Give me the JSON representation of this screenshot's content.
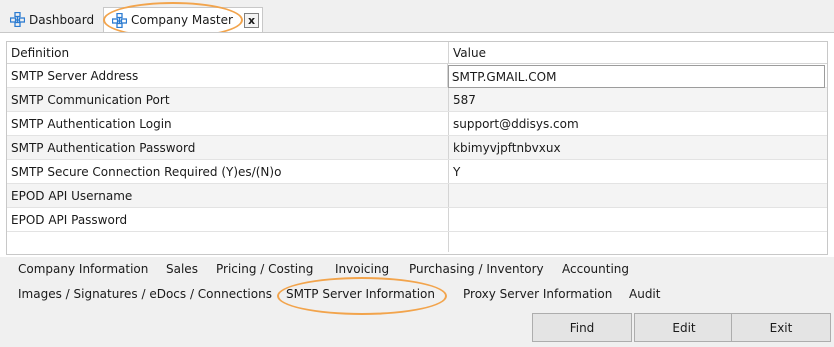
{
  "tabs": {
    "dashboard_label": "Dashboard",
    "company_label": "Company Master",
    "close_glyph": "x",
    "icon": "network-grid-icon",
    "icon_color": "#2b7bd1"
  },
  "grid": {
    "headers": {
      "definition": "Definition",
      "value": "Value"
    },
    "rows": [
      {
        "definition": "SMTP Server Address",
        "value": "SMTP.GMAIL.COM"
      },
      {
        "definition": "SMTP Communication Port",
        "value": "587"
      },
      {
        "definition": "SMTP Authentication Login",
        "value": "support@ddisys.com"
      },
      {
        "definition": "SMTP Authentication Password",
        "value": "kbimyvjpftnbvxux"
      },
      {
        "definition": "SMTP Secure Connection Required (Y)es/(N)o",
        "value": "Y"
      },
      {
        "definition": "EPOD API Username",
        "value": ""
      },
      {
        "definition": "EPOD API Password",
        "value": ""
      }
    ]
  },
  "sections": {
    "company_information": "Company Information",
    "sales": "Sales",
    "pricing_costing": "Pricing / Costing",
    "invoicing": "Invoicing",
    "purchasing_inventory": "Purchasing / Inventory",
    "accounting": "Accounting",
    "images_signatures": "Images / Signatures / eDocs / Connections",
    "smtp_server_information": "SMTP Server Information",
    "proxy_server_information": "Proxy Server Information",
    "audit": "Audit"
  },
  "buttons": {
    "find": "Find",
    "edit": "Edit",
    "exit": "Exit"
  },
  "colors": {
    "highlight": "#f2a44c",
    "alt_row": "#f4f4f4"
  }
}
